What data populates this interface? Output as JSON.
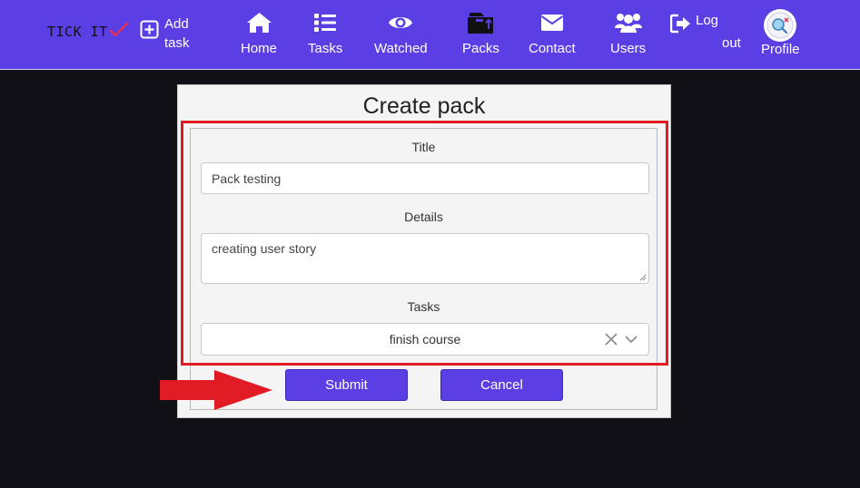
{
  "navbar": {
    "brand": "TICK IT",
    "add_task": [
      "Add",
      "task"
    ],
    "items": [
      {
        "label": "Home",
        "icon": "home-icon"
      },
      {
        "label": "Tasks",
        "icon": "list-icon"
      },
      {
        "label": "Watched",
        "icon": "eye-icon"
      },
      {
        "label": "Packs",
        "icon": "box-icon"
      },
      {
        "label": "Contact",
        "icon": "envelope-icon"
      },
      {
        "label": "Users",
        "icon": "users-icon"
      }
    ],
    "logout": [
      "Log",
      "out"
    ],
    "profile": "Profile"
  },
  "form": {
    "title": "Create pack",
    "title_label": "Title",
    "title_value": "Pack testing",
    "details_label": "Details",
    "details_value": "creating user story",
    "tasks_label": "Tasks",
    "tasks_selected": "finish course",
    "submit": "Submit",
    "cancel": "Cancel"
  },
  "colors": {
    "navbar": "#5b3fe4",
    "background": "#111014",
    "highlight": "#e01b24",
    "button": "#5b3fe4"
  }
}
